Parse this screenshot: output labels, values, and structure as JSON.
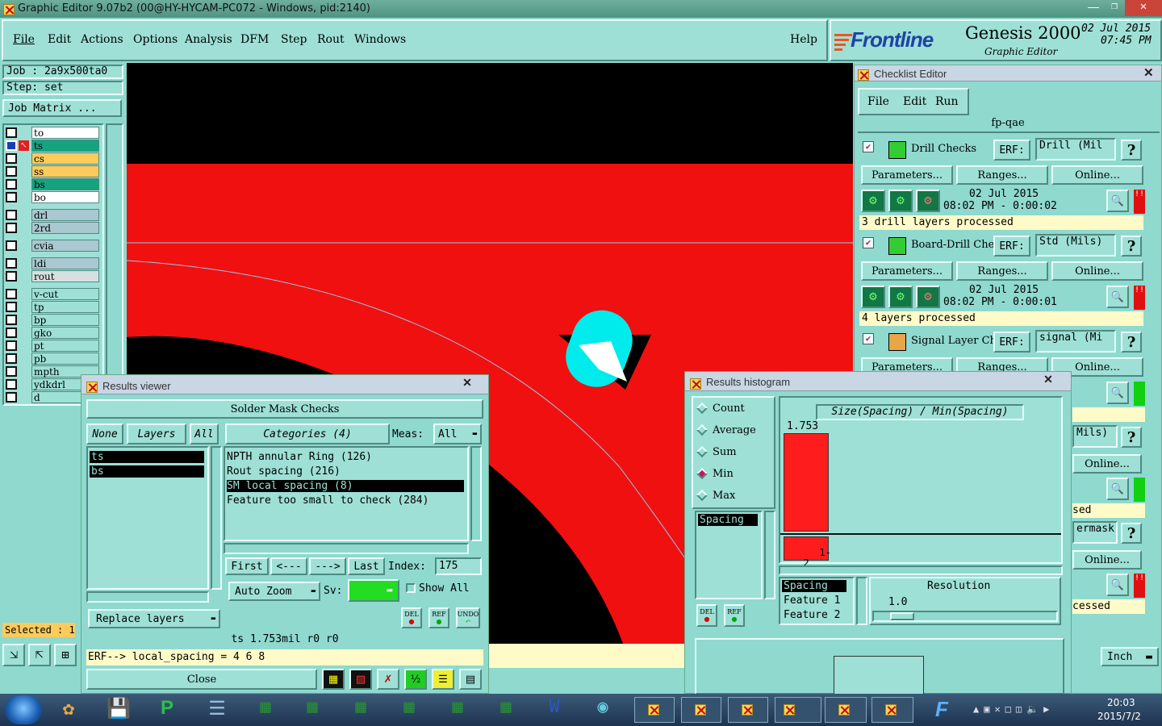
{
  "title_bar": {
    "title": "Graphic Editor 9.07b2 (00@HY-HYCAM-PC072 - Windows, pid:2140)"
  },
  "menu": {
    "items": [
      "File",
      "Edit",
      "Actions",
      "Options",
      "Analysis",
      "DFM",
      "Step",
      "Rout",
      "Windows"
    ],
    "help": "Help"
  },
  "brand": {
    "logo": "Frontline",
    "product": "Genesis 2000",
    "subtitle": "Graphic Editor",
    "date": "02 Jul 2015",
    "time": "07:45 PM"
  },
  "job": {
    "job_label": "Job : 2a9x500ta0",
    "step_label": "Step: set",
    "matrix_button": "Job Matrix ..."
  },
  "layers": [
    {
      "name": "to",
      "color": "#ffffff"
    },
    {
      "name": "ts",
      "color": "#16a37f",
      "active": true
    },
    {
      "name": "cs",
      "color": "#fccb5c"
    },
    {
      "name": "ss",
      "color": "#fccb5c"
    },
    {
      "name": "bs",
      "color": "#16a37f"
    },
    {
      "name": "bo",
      "color": "#ffffff"
    },
    {
      "name": "drl",
      "color": "#a9c8cf"
    },
    {
      "name": "2rd",
      "color": "#a9c8cf"
    },
    {
      "name": "cvia",
      "color": "#a9c8cf"
    },
    {
      "name": "ldi",
      "color": "#a9c8cf"
    },
    {
      "name": "rout",
      "color": "#d6e0e0"
    },
    {
      "name": "v-cut",
      "color": "#9ee0d6"
    },
    {
      "name": "tp",
      "color": "#9ee0d6"
    },
    {
      "name": "bp",
      "color": "#9ee0d6"
    },
    {
      "name": "gko",
      "color": "#9ee0d6"
    },
    {
      "name": "pt",
      "color": "#9ee0d6"
    },
    {
      "name": "pb",
      "color": "#9ee0d6"
    },
    {
      "name": "mpth",
      "color": "#9ee0d6"
    },
    {
      "name": "ydkdrl",
      "color": "#9ee0d6"
    },
    {
      "name": "d",
      "color": "#9ee0d6"
    }
  ],
  "selected_label": "Selected : 1",
  "units": "Inch",
  "checklist": {
    "title": "Checklist Editor",
    "menu": [
      "File",
      "Edit",
      "Run"
    ],
    "name": "fp-qae",
    "checks": [
      {
        "name": "Drill Checks",
        "erf": "Drill (Mil",
        "date": "02 Jul 2015",
        "time": "08:02 PM - 0:00:02",
        "status": "3 drill layers processed"
      },
      {
        "name": "Board-Drill Che",
        "erf": "Std (Mils)",
        "date": "02 Jul 2015",
        "time": "08:02 PM - 0:00:01",
        "status": "4 layers processed"
      },
      {
        "name": "Signal Layer Ch",
        "erf": "signal (Mi"
      }
    ],
    "erf_label": "ERF:",
    "parameters": "Parameters...",
    "ranges": "Ranges...",
    "online": "Online...",
    "partial": [
      "Mils)",
      "Online...",
      "sed",
      "ermask",
      "Online...",
      "cessed"
    ]
  },
  "results_viewer": {
    "title": "Results viewer",
    "heading": "Solder Mask Checks",
    "none_btn": "None",
    "layers_btn": "Layers",
    "all_btn": "All",
    "categories_btn": "Categories (4)",
    "meas_label": "Meas:",
    "meas_value": "All",
    "layer_list": [
      "ts",
      "bs"
    ],
    "categories": [
      "NPTH annular Ring (126)",
      "Rout spacing (216)",
      "SM local spacing (8)",
      "Feature too small to check (284)"
    ],
    "first": "First",
    "prev": "<---",
    "next": "--->",
    "last": "Last",
    "index_label": "Index:",
    "index_value": "175",
    "auto_zoom": "Auto Zoom",
    "sv_label": "Sv:",
    "show_all": "Show All",
    "replace_layers": "Replace layers",
    "del": "DEL",
    "ref": "REF",
    "undo": "UNDO",
    "status": "ts 1.753mil  r0  r0",
    "erf_line": "ERF--> local_spacing = 4 6 8",
    "close": "Close"
  },
  "histogram": {
    "title": "Results histogram",
    "options": [
      "Count",
      "Average",
      "Sum",
      "Min",
      "Max"
    ],
    "selected_option": "Min",
    "list_left": [
      "Spacing"
    ],
    "del": "DEL",
    "ref": "REF",
    "chart_title": "Size(Spacing) / Min(Spacing)",
    "bar_value": "1.753",
    "bar_label": "1-\n2",
    "list_right": [
      "Spacing",
      "Feature 1",
      "Feature 2"
    ],
    "resolution_label": "Resolution",
    "resolution_value": "1.0"
  },
  "taskbar": {
    "time": "20:03",
    "date": "2015/7/2"
  }
}
